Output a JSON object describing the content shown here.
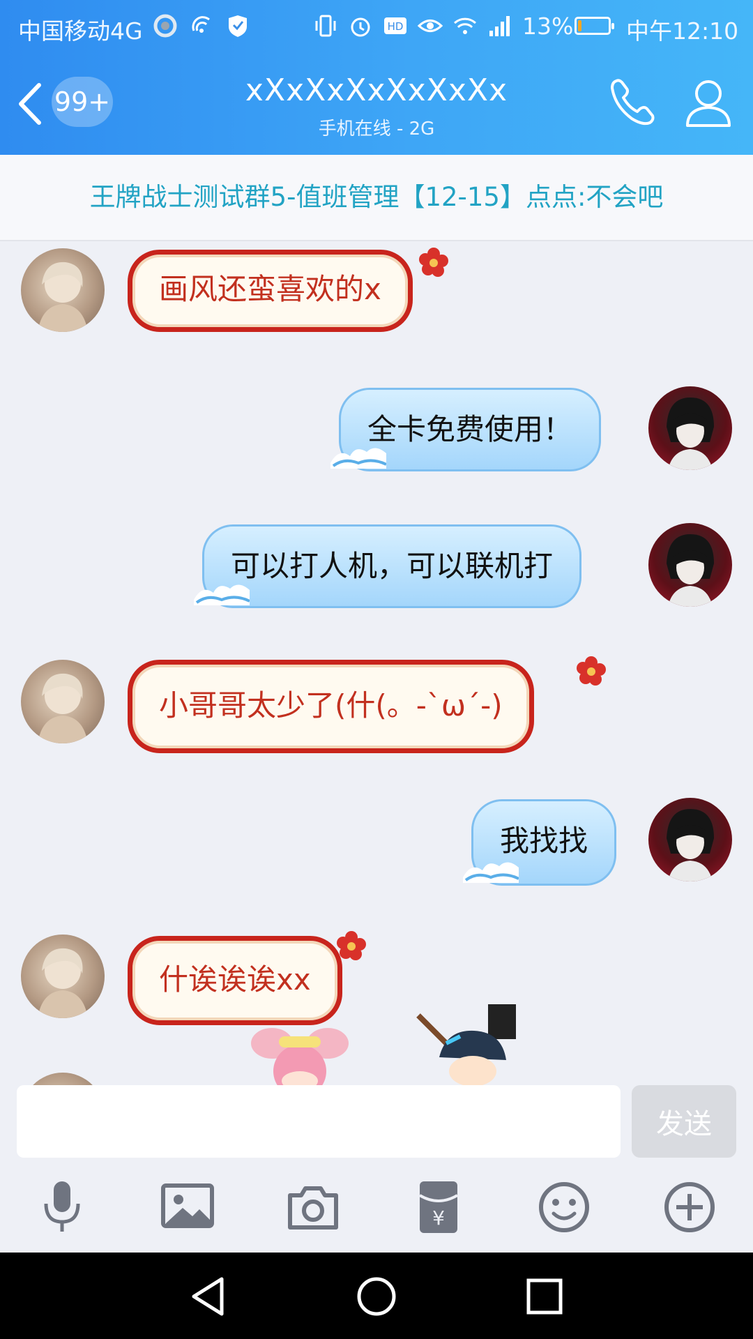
{
  "status_bar": {
    "carrier": "中国移动4G",
    "battery": "13%",
    "battery_level": 0.13,
    "time": "中午12:10"
  },
  "header": {
    "unread": "99+",
    "title": "xXxXxXxXxXxXx",
    "subtitle": "手机在线 - 2G"
  },
  "notice": {
    "text": "王牌战士测试群5-值班管理【12-15】点点:不会吧"
  },
  "messages": [
    {
      "side": "left",
      "text": "画风还蛮喜欢的x"
    },
    {
      "side": "right",
      "text": "全卡免费使用！"
    },
    {
      "side": "right",
      "text": "可以打人机，可以联机打"
    },
    {
      "side": "left",
      "text": "小哥哥太少了(什(。-`ω´-)"
    },
    {
      "side": "right",
      "text": "我找找"
    },
    {
      "side": "left",
      "text": "什诶诶诶xx"
    }
  ],
  "input": {
    "value": "",
    "placeholder": "",
    "send_label": "发送"
  },
  "toolbar": [
    "microphone-icon",
    "image-icon",
    "camera-icon",
    "red-packet-icon",
    "emoji-icon",
    "plus-icon"
  ],
  "colors": {
    "header_blue": "#3ea6f6",
    "notice_text": "#22a3c4",
    "left_bubble_border": "#c8241c",
    "left_bubble_text": "#c2301f",
    "right_bubble": "#a4d6fb"
  }
}
